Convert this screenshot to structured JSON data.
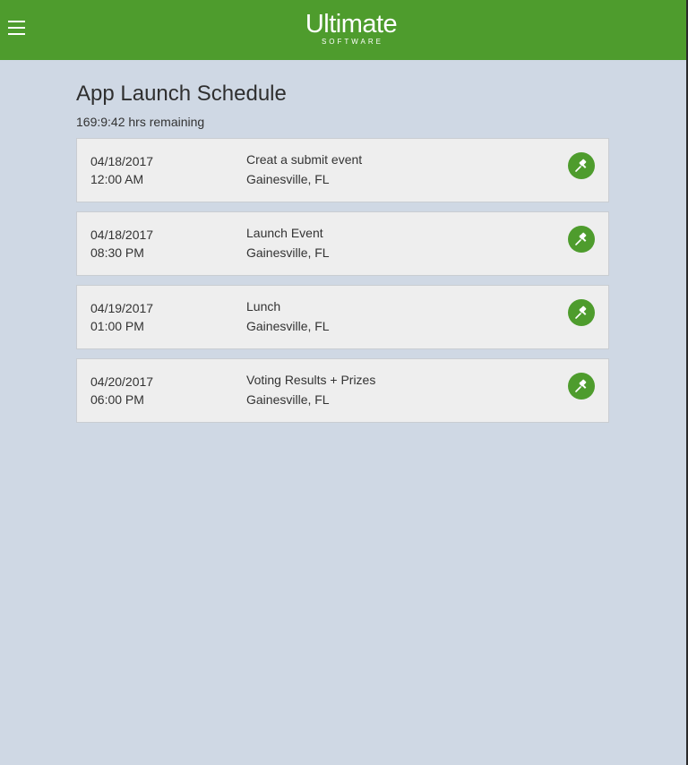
{
  "header": {
    "logo_main": "Ultimate",
    "logo_sub": "SOFTWARE",
    "brand_color": "#4e9c2d"
  },
  "page": {
    "title": "App Launch Schedule",
    "remaining": "169:9:42 hrs remaining"
  },
  "events": [
    {
      "date": "04/18/2017",
      "time": "12:00 AM",
      "title": "Creat a submit event",
      "location": "Gainesville, FL",
      "icon": "pin-icon"
    },
    {
      "date": "04/18/2017",
      "time": "08:30 PM",
      "title": "Launch Event",
      "location": "Gainesville, FL",
      "icon": "pin-icon"
    },
    {
      "date": "04/19/2017",
      "time": "01:00 PM",
      "title": "Lunch",
      "location": "Gainesville, FL",
      "icon": "pin-icon"
    },
    {
      "date": "04/20/2017",
      "time": "06:00 PM",
      "title": "Voting Results + Prizes",
      "location": "Gainesville, FL",
      "icon": "pin-icon"
    }
  ]
}
